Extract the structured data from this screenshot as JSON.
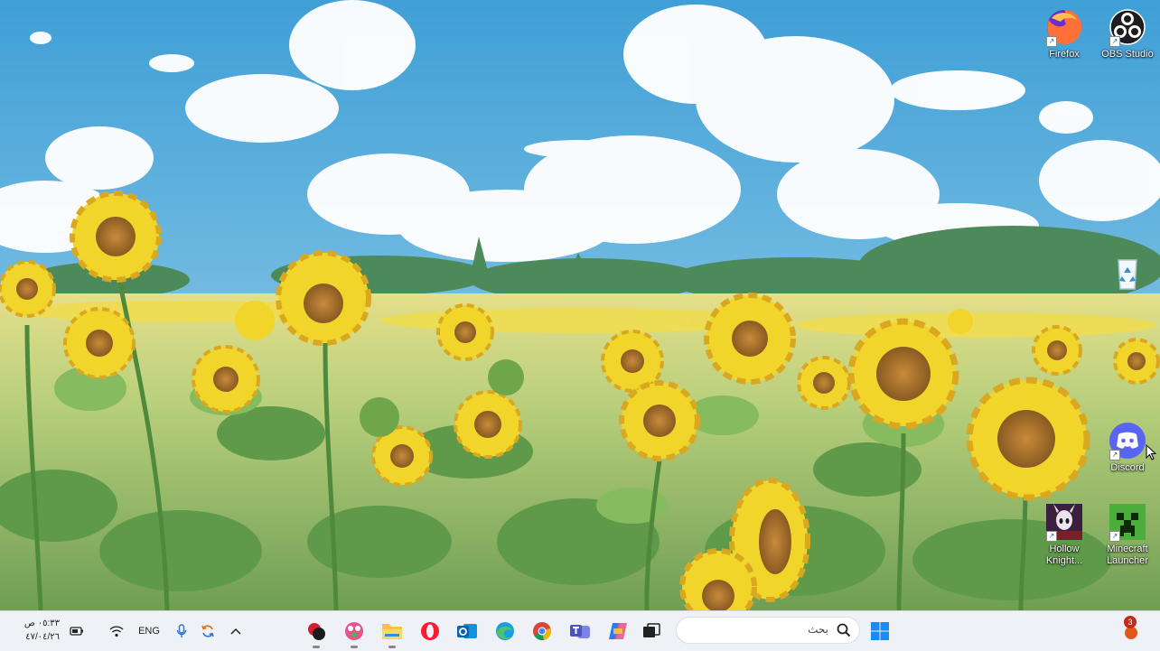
{
  "desktop": {
    "icons": [
      {
        "label": "Firefox",
        "icon": "firefox-icon"
      },
      {
        "label": "OBS Studio",
        "icon": "obs-studio-icon"
      },
      {
        "label": "",
        "icon": "recycle-bin-icon"
      },
      {
        "label": "Discord",
        "icon": "discord-icon"
      },
      {
        "label": "Hollow Knight...",
        "icon": "hollow-knight-icon"
      },
      {
        "label": "Minecraft Launcher",
        "icon": "minecraft-launcher-icon"
      }
    ]
  },
  "taskbar": {
    "clock": {
      "time": "٠٥:٣٣ ص",
      "date": "٤٧/٠٤/٢٦"
    },
    "language": "ENG",
    "search": {
      "placeholder": "بحث"
    },
    "notification_badge": "3",
    "tray_icons": [
      "battery-icon",
      "wifi-icon",
      "microphone-icon",
      "sync-icon",
      "chevron-up-icon"
    ],
    "apps": [
      "app-icon-1",
      "app-icon-2",
      "file-explorer-icon",
      "opera-icon",
      "outlook-icon",
      "edge-icon",
      "chrome-icon",
      "teams-icon",
      "copilot-icon",
      "task-view-icon"
    ]
  },
  "colors": {
    "taskbar_bg": "#eef1f5",
    "sky": "#5ab3dc",
    "sunflower": "#f2d52a"
  }
}
